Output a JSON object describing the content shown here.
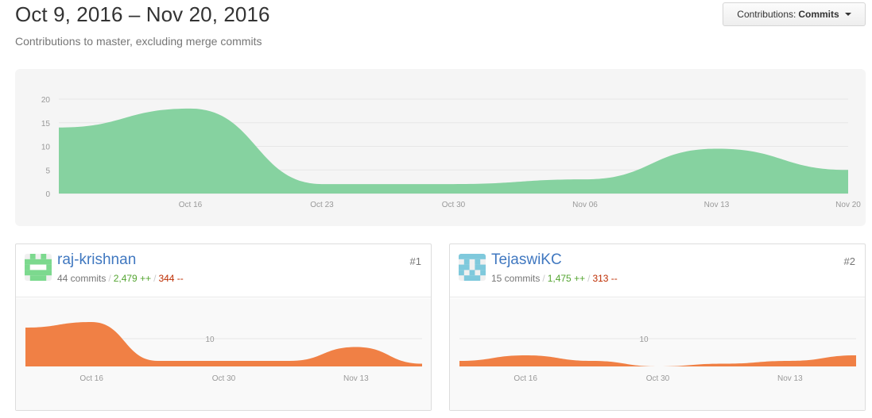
{
  "header": {
    "date_range": "Oct 9, 2016 – Nov 20, 2016",
    "subtitle": "Contributions to master, excluding merge commits"
  },
  "dropdown": {
    "label": "Contributions:",
    "value": "Commits",
    "caret_icon": "caret-down-icon"
  },
  "colors": {
    "main_area": "#86d2a0",
    "contributor_area": "#f08045",
    "additions": "#55a532",
    "deletions": "#bd2c00",
    "link": "#4078c0"
  },
  "chart_data": [
    {
      "type": "area",
      "title": "",
      "x": [
        "Oct 9",
        "Oct 16",
        "Oct 23",
        "Oct 30",
        "Nov 06",
        "Nov 13",
        "Nov 20"
      ],
      "x_tick_labels": [
        "Oct 16",
        "Oct 23",
        "Oct 30",
        "Nov 06",
        "Nov 13",
        "Nov 20"
      ],
      "y_tick_labels": [
        "0",
        "5",
        "10",
        "15",
        "20"
      ],
      "ylim": [
        0,
        20
      ],
      "series": [
        {
          "values": [
            14,
            18,
            2,
            2,
            3,
            9.5,
            5
          ]
        }
      ],
      "grid": true
    },
    {
      "type": "area",
      "title": "",
      "x": [
        "Oct 9",
        "Oct 16",
        "Oct 23",
        "Oct 30",
        "Nov 06",
        "Nov 13",
        "Nov 20"
      ],
      "x_tick_labels": [
        "Oct 16",
        "Oct 30",
        "Nov 13"
      ],
      "y_tick_labels": [
        "10"
      ],
      "ylim": [
        0,
        20
      ],
      "series": [
        {
          "values": [
            14,
            16,
            2,
            2,
            2,
            7,
            1
          ]
        }
      ]
    },
    {
      "type": "area",
      "title": "",
      "x": [
        "Oct 9",
        "Oct 16",
        "Oct 23",
        "Oct 30",
        "Nov 06",
        "Nov 13",
        "Nov 20"
      ],
      "x_tick_labels": [
        "Oct 16",
        "Oct 30",
        "Nov 13"
      ],
      "y_tick_labels": [
        "10"
      ],
      "ylim": [
        0,
        20
      ],
      "series": [
        {
          "values": [
            2,
            4,
            2,
            0,
            1,
            2,
            4
          ]
        }
      ]
    }
  ],
  "contributors": [
    {
      "name": "raj-krishnan",
      "commits": "44 commits",
      "additions": "2,479 ++",
      "deletions": "344 --",
      "rank": "#1",
      "avatar_icon": "identicon-green-icon"
    },
    {
      "name": "TejaswiKC",
      "commits": "15 commits",
      "additions": "1,475 ++",
      "deletions": "313 --",
      "rank": "#2",
      "avatar_icon": "identicon-blue-icon"
    }
  ]
}
